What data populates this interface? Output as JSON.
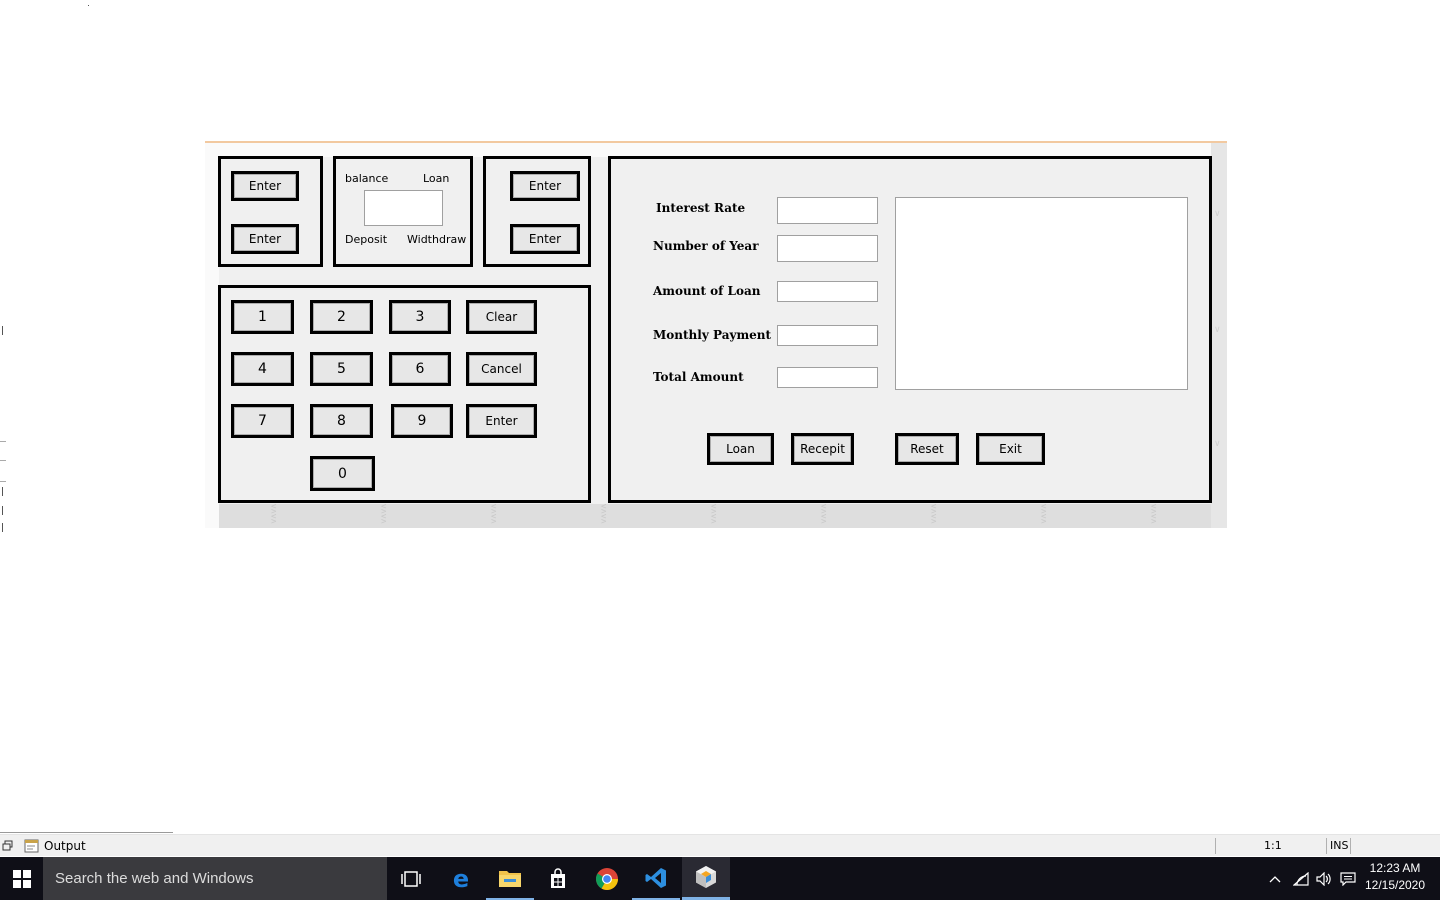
{
  "atm_form": {
    "top_left_panel": {
      "enter_button_1": "Enter",
      "enter_button_2": "Enter"
    },
    "center_panel": {
      "balance_label": "balance",
      "loan_label": "Loan",
      "display_value": "",
      "deposit_label": "Deposit",
      "withdraw_label": "Widthdraw"
    },
    "top_right_panel": {
      "enter_button_1": "Enter",
      "enter_button_2": "Enter"
    },
    "keypad": {
      "keys": [
        "1",
        "2",
        "3",
        "4",
        "5",
        "6",
        "7",
        "8",
        "9",
        "0"
      ],
      "clear": "Clear",
      "cancel": "Cancel",
      "enter": "Enter"
    },
    "loan_panel": {
      "interest_rate_label": "Interest Rate",
      "years_label": "Number of Year",
      "amount_label": "Amount of Loan",
      "monthly_label": "Monthly Payment",
      "total_label": "Total Amount",
      "interest_rate_value": "",
      "years_value": "",
      "amount_value": "",
      "monthly_value": "",
      "total_value": "",
      "receipt_text": "",
      "loan_button": "Loan",
      "receipt_button": "Recepit",
      "reset_button": "Reset",
      "exit_button": "Exit"
    }
  },
  "output_bar": {
    "tab_label": "Output",
    "cursor_position": "1:1",
    "insert_mode": "INS"
  },
  "taskbar": {
    "search_placeholder": "Search the web and Windows",
    "time": "12:23 AM",
    "date": "12/15/2020",
    "apps": [
      "task-view-icon",
      "edge-icon",
      "file-explorer-icon",
      "store-icon",
      "chrome-icon",
      "vscode-icon",
      "netbeans-icon"
    ]
  }
}
